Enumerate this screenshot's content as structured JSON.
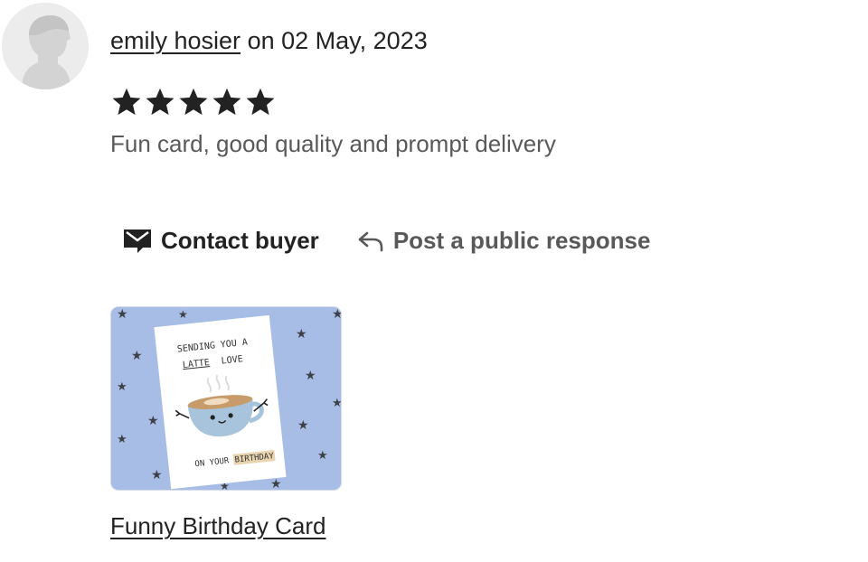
{
  "review": {
    "reviewer_name": "emily hosier",
    "date_prefix": "on",
    "date": "02 May, 2023",
    "rating": 5,
    "rating_max": 5,
    "text": "Fun card, good quality and prompt delivery"
  },
  "actions": {
    "contact_label": "Contact buyer",
    "contact_icon": "envelope-icon",
    "respond_label": "Post a public response",
    "respond_icon": "reply-arrow-icon"
  },
  "product": {
    "name": "Funny Birthday Card",
    "card_text": {
      "line1": "SENDING YOU A",
      "line2_underlined": "LATTE",
      "line2_rest": "LOVE",
      "line3_prefix": "ON YOUR",
      "line3_highlight": "BIRTHDAY"
    }
  },
  "colors": {
    "text_primary": "#222222",
    "text_secondary": "#595959",
    "star": "#222222",
    "thumbnail_background": "#a8bde6",
    "avatar_background": "#ececec"
  }
}
